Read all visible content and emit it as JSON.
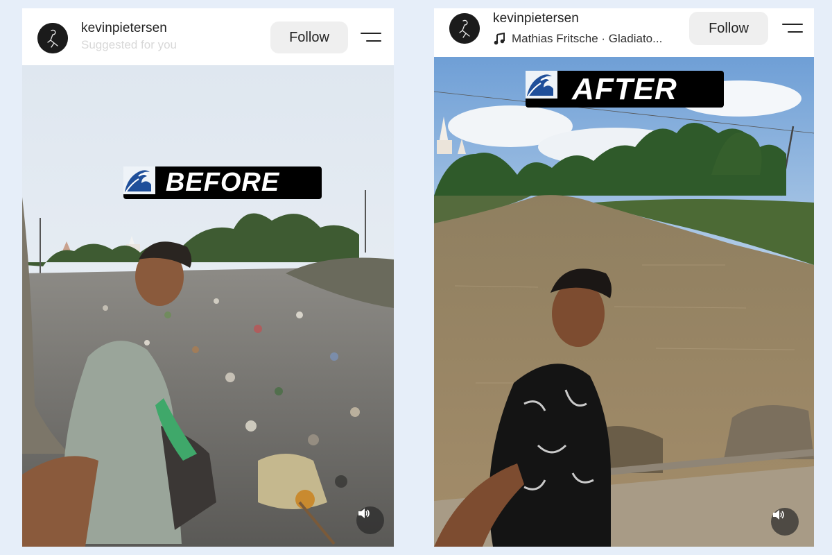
{
  "posts": {
    "left": {
      "username": "kevinpietersen",
      "subline": "Suggested for you",
      "follow_label": "Follow",
      "tag_text": "BEFORE"
    },
    "right": {
      "username": "kevinpietersen",
      "music_text": "Mathias Fritsche · Gladiato...",
      "follow_label": "Follow",
      "tag_text": "AFTER"
    }
  },
  "icons": {
    "menu": "menu-icon",
    "music": "music-note-icon",
    "wave": "wave-icon",
    "sound": "speaker-icon",
    "avatar": "avatar"
  },
  "colors": {
    "page_background": "#e6eef9",
    "tag_background": "#000000",
    "follow_button": "#efefef"
  }
}
